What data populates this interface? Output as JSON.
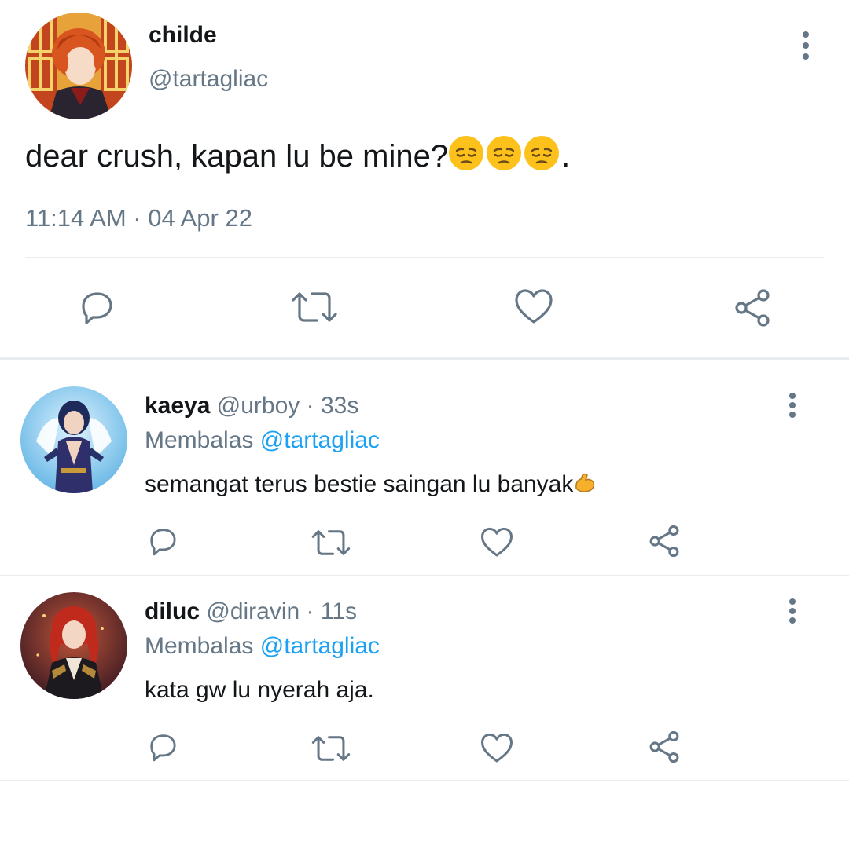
{
  "main_tweet": {
    "name": "childe",
    "handle": "@tartagliac",
    "text": "dear crush, kapan lu be mine?",
    "text_suffix": ".",
    "emojis": [
      "pensive-face",
      "pensive-face",
      "pensive-face"
    ],
    "timestamp": "11:14 AM · 04 Apr 22"
  },
  "actions": [
    "reply-icon",
    "retweet-icon",
    "like-icon",
    "share-icon"
  ],
  "replies": [
    {
      "name": "kaeya",
      "handle": "@urboy",
      "separator": "·",
      "time": "33s",
      "replying_label": "Membalas",
      "replying_to": "@tartagliac",
      "text": "semangat terus bestie saingan lu banyak",
      "emoji": "flexed-biceps"
    },
    {
      "name": "diluc",
      "handle": "@diravin",
      "separator": "·",
      "time": "11s",
      "replying_label": "Membalas",
      "replying_to": "@tartagliac",
      "text": "kata gw lu nyerah aja.",
      "emoji": ""
    }
  ],
  "colors": {
    "text": "#14171a",
    "secondary": "#657786",
    "accent": "#1da1f2",
    "divider": "#e6ecf0"
  }
}
